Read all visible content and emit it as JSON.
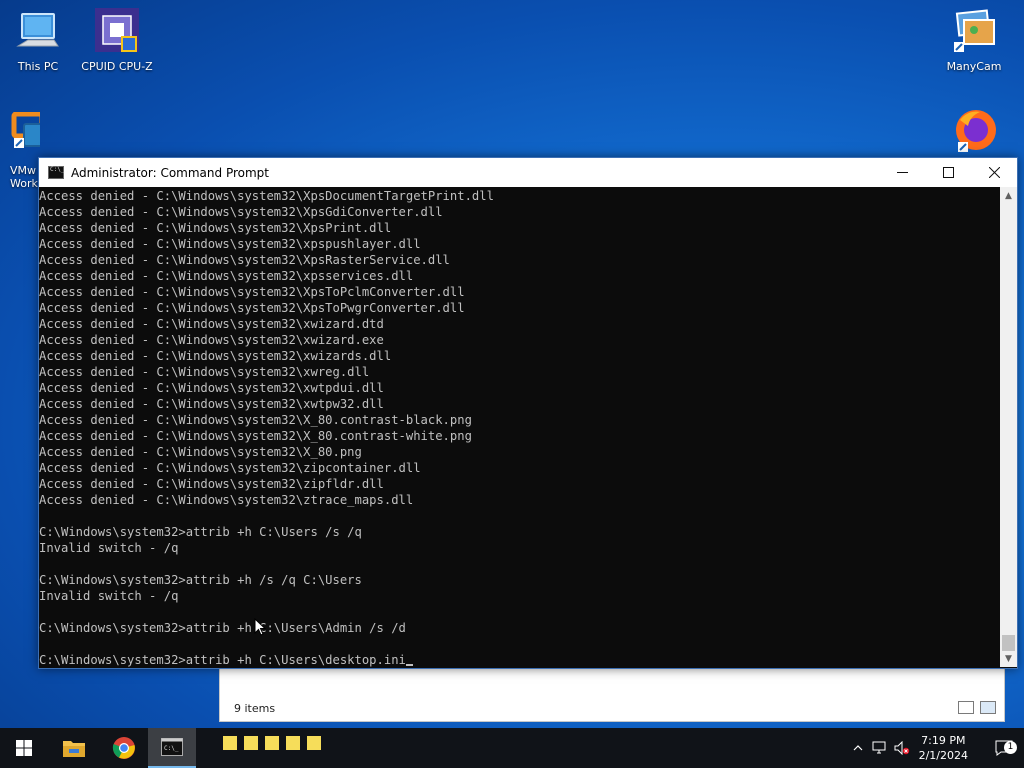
{
  "desktop": {
    "icons": [
      {
        "label": "This PC",
        "icon": "computer-icon"
      },
      {
        "label": "CPUID CPU-Z",
        "icon": "cpuz-icon"
      },
      {
        "label": "VMw\nWork",
        "icon": "vmware-icon"
      },
      {
        "label": "ManyCam",
        "icon": "manycam-icon"
      },
      {
        "label": "",
        "icon": "firefox-icon"
      }
    ]
  },
  "cmd_window": {
    "title": "Administrator: Command Prompt",
    "lines": [
      "Access denied - C:\\Windows\\system32\\XpsDocumentTargetPrint.dll",
      "Access denied - C:\\Windows\\system32\\XpsGdiConverter.dll",
      "Access denied - C:\\Windows\\system32\\XpsPrint.dll",
      "Access denied - C:\\Windows\\system32\\xpspushlayer.dll",
      "Access denied - C:\\Windows\\system32\\XpsRasterService.dll",
      "Access denied - C:\\Windows\\system32\\xpsservices.dll",
      "Access denied - C:\\Windows\\system32\\XpsToPclmConverter.dll",
      "Access denied - C:\\Windows\\system32\\XpsToPwgrConverter.dll",
      "Access denied - C:\\Windows\\system32\\xwizard.dtd",
      "Access denied - C:\\Windows\\system32\\xwizard.exe",
      "Access denied - C:\\Windows\\system32\\xwizards.dll",
      "Access denied - C:\\Windows\\system32\\xwreg.dll",
      "Access denied - C:\\Windows\\system32\\xwtpdui.dll",
      "Access denied - C:\\Windows\\system32\\xwtpw32.dll",
      "Access denied - C:\\Windows\\system32\\X_80.contrast-black.png",
      "Access denied - C:\\Windows\\system32\\X_80.contrast-white.png",
      "Access denied - C:\\Windows\\system32\\X_80.png",
      "Access denied - C:\\Windows\\system32\\zipcontainer.dll",
      "Access denied - C:\\Windows\\system32\\zipfldr.dll",
      "Access denied - C:\\Windows\\system32\\ztrace_maps.dll",
      "",
      "C:\\Windows\\system32>attrib +h C:\\Users /s /q",
      "Invalid switch - /q",
      "",
      "C:\\Windows\\system32>attrib +h /s /q C:\\Users",
      "Invalid switch - /q",
      "",
      "C:\\Windows\\system32>attrib +h C:\\Users\\Admin /s /d",
      ""
    ],
    "prompt_line": "C:\\Windows\\system32>attrib +h C:\\Users\\desktop.ini"
  },
  "explorer_window": {
    "status": "9 items"
  },
  "taskbar": {
    "clock_time": "7:19 PM",
    "clock_date": "2/1/2024",
    "notification_count": "1"
  },
  "colors": {
    "console_bg": "#0c0c0c",
    "console_fg": "#c0c0c0",
    "taskbar_bg": "#101318",
    "accent": "#76b9ed"
  }
}
